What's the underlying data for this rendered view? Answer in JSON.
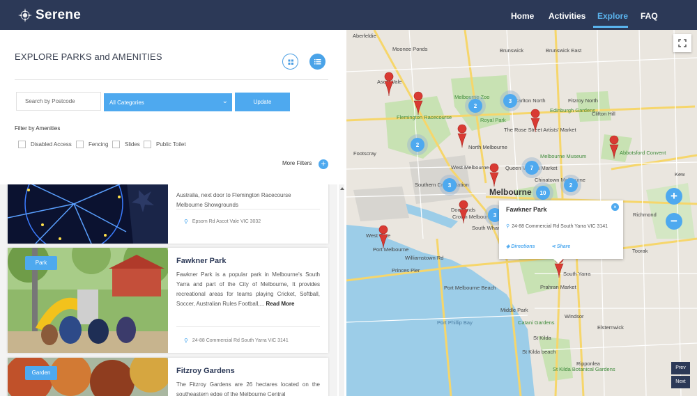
{
  "brand": {
    "name": "Serene"
  },
  "nav": [
    {
      "label": "Home",
      "active": false
    },
    {
      "label": "Activities",
      "active": false
    },
    {
      "label": "Explore",
      "active": true
    },
    {
      "label": "FAQ",
      "active": false
    }
  ],
  "explore": {
    "title": "EXPLORE PARKS and AMENITIES",
    "search_placeholder": "Search by Postcode",
    "category_value": "All Categories",
    "update_label": "Update",
    "filter_label": "Filter by Amenities",
    "amenities": [
      "Disabled Access",
      "Fencing",
      "Slides",
      "Public Toilet"
    ],
    "more_filters": "More Filters",
    "plus": "+"
  },
  "cards": [
    {
      "desc_partial_line1": "Australia, next door to Flemington Racecourse",
      "desc_partial_line2": "Melbourne Showgrounds",
      "address": "Epsom Rd Ascot Vale VIC 3032"
    },
    {
      "tag": "Park",
      "title": "Fawkner Park",
      "desc": "Fawkner Park is a popular park in Melbourne's South Yarra and part of the City of Melbourne, It provides recreational areas for teams playing Cricket, Softball, Soccer, Australian Rules Football,...",
      "read_more": "Read More",
      "address": "24-88 Commercial Rd South Yarra VIC 3141"
    },
    {
      "tag": "Garden",
      "title": "Fitzroy Gardens",
      "desc": "The Fitzroy Gardens are 26 hectares located on the southeastern edge of the Melbourne Central"
    }
  ],
  "map": {
    "popup": {
      "title": "Fawkner Park",
      "address": "24-88 Commercial Rd South Yarra VIC 3141",
      "directions": "Directions",
      "share": "Share",
      "close": "×"
    },
    "zoom_in": "+",
    "zoom_out": "−",
    "prev": "Prev",
    "next": "Next",
    "clusters": [
      "2",
      "3",
      "2",
      "7",
      "3",
      "2",
      "10",
      "3"
    ],
    "labels": {
      "aberfeldie": "Aberfeldie",
      "moonee_ponds": "Moonee Ponds",
      "brunswick": "Brunswick",
      "brunswick_east": "Brunswick East",
      "ascot_vale": "Ascot Vale",
      "melbourne_zoo": "Melbourne Zoo",
      "carlton_north": "Carlton North",
      "fitzroy_north": "Fitzroy North",
      "flemington_racecourse": "Flemington Racecourse",
      "royal_park": "Royal Park",
      "edinburgh_gardens": "Edinburgh Gardens",
      "clifton_hill": "Clifton Hill",
      "rose_street": "The Rose Street Artists' Market",
      "abbotsford": "Abbotsford Convent",
      "north_melbourne": "North Melbourne",
      "melbourne_museum": "Melbourne Museum",
      "queen_victoria": "Queen Victoria Market",
      "kew": "Kew",
      "chinatown": "Chinatown Melbourne",
      "south_wharf": "South Wharf",
      "melbourne": "Melbourne",
      "docklands": "Docklands",
      "crown": "Crown Melbourne",
      "richmond": "Richmond",
      "west_gate": "West Gate",
      "port_melbourne": "Port Melbourne",
      "williamstown": "Williamstown Rd",
      "princes_pier": "Princes Pier",
      "south_yarra": "South Yarra",
      "prahran": "Prahran Market",
      "port_beach": "Port Melbourne Beach",
      "middle_park": "Middle Park",
      "windsor": "Windsor",
      "port_phillip": "Port Phillip Bay",
      "catani": "Catani Gardens",
      "st_kilda": "St Kilda",
      "st_kilda_beach": "St Kilda beach",
      "botanical": "St Kilda Botanical Gardens",
      "ripponlea": "Ripponlea",
      "elsternwick": "Elsternwick",
      "toorak": "Toorak",
      "west_melbourne": "West Melbourne",
      "southern_cross": "Southern Cross Station",
      "footscray": "Footscray"
    }
  },
  "colors": {
    "navbar": "#2c3957",
    "accent": "#4ea9ef",
    "marker": "#d93a33",
    "water": "#9ccde8",
    "park": "#c8e2b3"
  }
}
